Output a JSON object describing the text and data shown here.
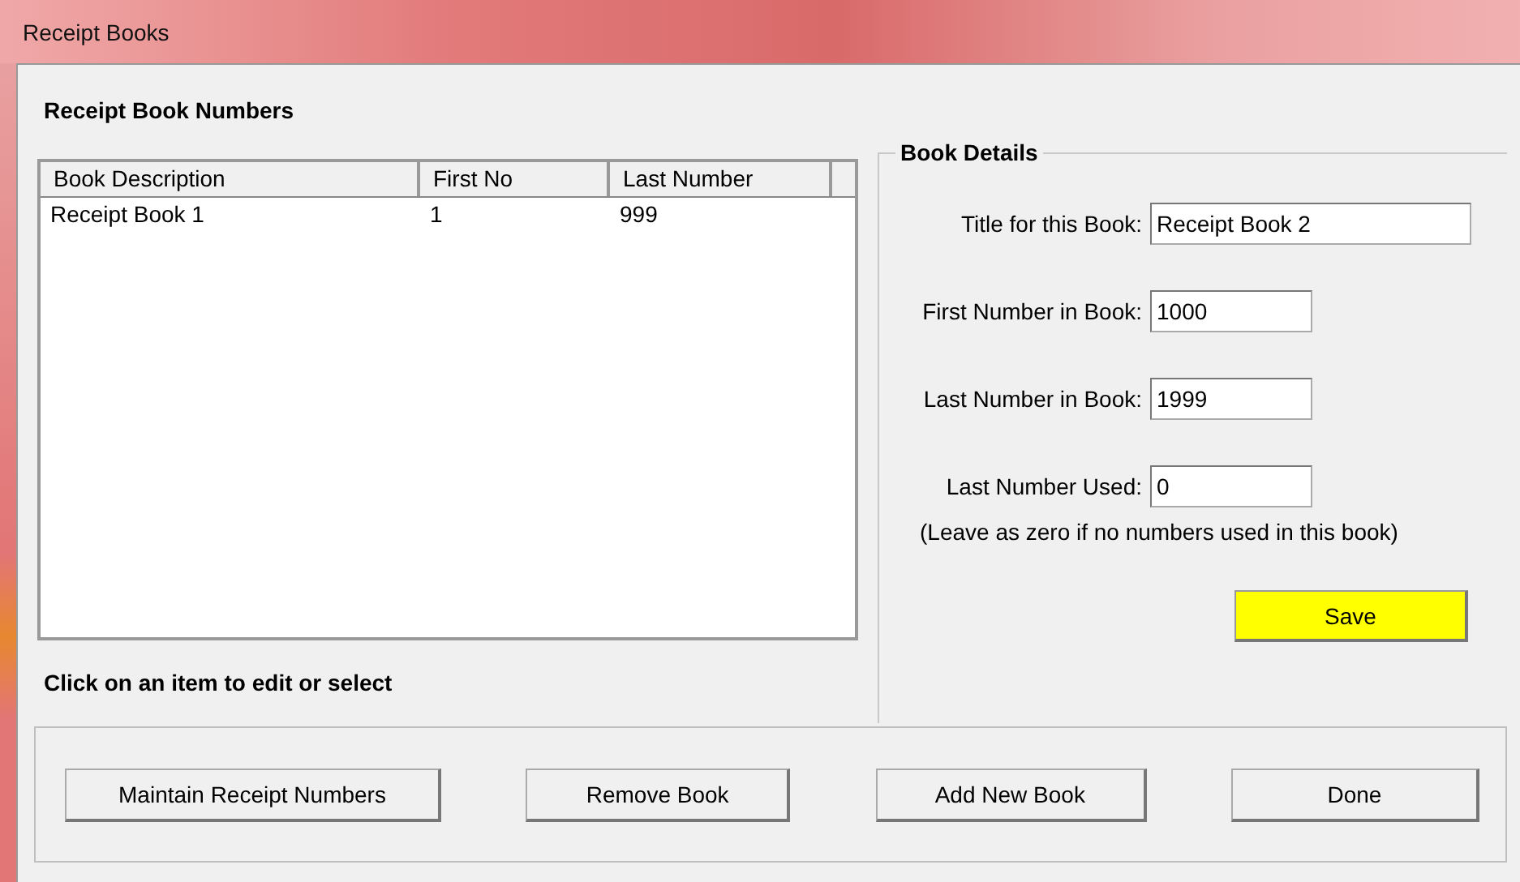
{
  "window": {
    "title": "Receipt Books"
  },
  "list_panel": {
    "heading": "Receipt Book Numbers",
    "columns": [
      "Book Description",
      "First No",
      "Last Number"
    ],
    "rows": [
      {
        "cells": [
          "Receipt Book 1",
          "1",
          "999"
        ],
        "selected": false
      }
    ],
    "hint": "Click on an item to edit or select"
  },
  "book_details": {
    "legend": "Book Details",
    "fields": [
      {
        "label": "Title for this Book:",
        "value": "Receipt Book 2",
        "wide": true
      },
      {
        "label": "First Number in Book:",
        "value": "1000",
        "wide": false
      },
      {
        "label": "Last Number in Book:",
        "value": "1999",
        "wide": false
      },
      {
        "label": "Last Number Used:",
        "value": "0",
        "wide": false
      }
    ],
    "note": "(Leave as zero if no numbers used in this book)",
    "save_button": "Save"
  },
  "buttons": [
    "Maintain Receipt Numbers",
    "Remove Book",
    "Add New Book",
    "Done"
  ]
}
